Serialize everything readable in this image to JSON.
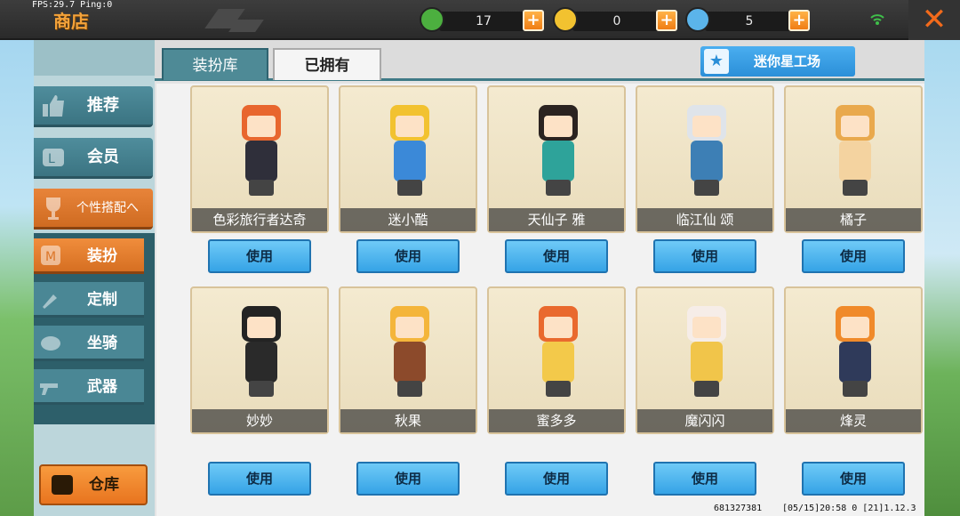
{
  "status": {
    "fps_text": "FPS:29.7  Ping:0"
  },
  "header": {
    "title": "商店"
  },
  "currencies": [
    {
      "name": "green-gem",
      "value": "17",
      "color": "#4caf3f"
    },
    {
      "name": "gold-coin",
      "value": "0",
      "color": "#f2c230"
    },
    {
      "name": "star-coin",
      "value": "5",
      "color": "#5bb4ea"
    }
  ],
  "sidebar": {
    "recommend": "推荐",
    "member": "会员",
    "custom_section": "个性搭配へ",
    "subitems": [
      "装扮",
      "定制",
      "坐骑",
      "武器"
    ],
    "warehouse": "仓库"
  },
  "tabs": {
    "active": "装扮库",
    "inactive": "已拥有"
  },
  "workshop": {
    "label": "迷你星工场"
  },
  "skins": [
    {
      "name": "色彩旅行者达奇",
      "hair": "#e8662e",
      "body": "#2f2f3a",
      "use": "使用"
    },
    {
      "name": "迷小酷",
      "hair": "#f2c230",
      "body": "#3b89d8",
      "use": "使用"
    },
    {
      "name": "天仙子 雅",
      "hair": "#2b2320",
      "body": "#2ea39a",
      "use": "使用"
    },
    {
      "name": "临江仙 颂",
      "hair": "#dfe4ea",
      "body": "#3d7fb5",
      "use": "使用"
    },
    {
      "name": "橘子",
      "hair": "#e9a94d",
      "body": "#f4d3a0",
      "use": "使用"
    },
    {
      "name": "妙妙",
      "hair": "#232323",
      "body": "#2a2a2a",
      "use": "使用"
    },
    {
      "name": "秋果",
      "hair": "#f4b53a",
      "body": "#8c4a2b",
      "use": "使用"
    },
    {
      "name": "蜜多多",
      "hair": "#e9692e",
      "body": "#f3c94a",
      "use": "使用"
    },
    {
      "name": "魔闪闪",
      "hair": "#f6ede8",
      "body": "#f1c54a",
      "use": "使用"
    },
    {
      "name": "烽灵",
      "hair": "#f08a2a",
      "body": "#2f3a5a",
      "use": "使用"
    }
  ],
  "footer": {
    "uid": "681327381",
    "build": "[05/15]20:58 0  [21]1.12.3"
  }
}
